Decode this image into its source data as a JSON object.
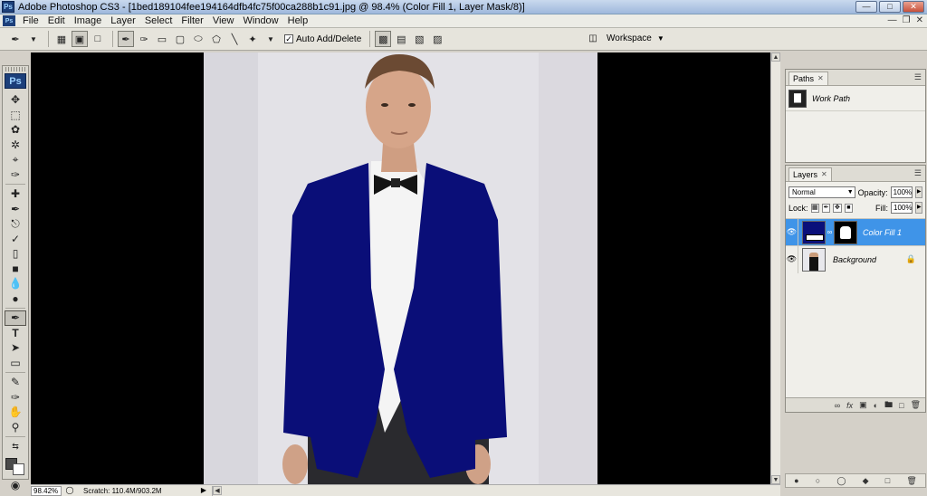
{
  "window": {
    "title": "Adobe Photoshop CS3 - [1bed189104fee194164dfb4fc75f00ca288b1c91.jpg @ 98.4% (Color Fill 1, Layer Mask/8)]",
    "app_badge": "Ps"
  },
  "menu": {
    "items": [
      "File",
      "Edit",
      "Image",
      "Layer",
      "Select",
      "Filter",
      "View",
      "Window",
      "Help"
    ]
  },
  "options": {
    "auto_add_delete_label": "Auto Add/Delete",
    "auto_add_delete_checked": true,
    "workspace_label": "Workspace"
  },
  "toolbox": {
    "logo": "Ps"
  },
  "status": {
    "zoom": "98.42%",
    "scratch": "Scratch: 110.4M/903.2M"
  },
  "paths_panel": {
    "tab": "Paths",
    "items": [
      {
        "name": "Work Path"
      }
    ]
  },
  "layers_panel": {
    "tab": "Layers",
    "blend_mode": "Normal",
    "opacity_label": "Opacity:",
    "opacity": "100%",
    "lock_label": "Lock:",
    "fill_label": "Fill:",
    "fill": "100%",
    "layers": [
      {
        "name": "Color Fill 1",
        "selected": true
      },
      {
        "name": "Background",
        "selected": false
      }
    ]
  },
  "colors": {
    "jacket": "#0a0e78",
    "selection": "#3f94e8",
    "foreground": "#4a4a4a",
    "background": "#ffffff"
  }
}
